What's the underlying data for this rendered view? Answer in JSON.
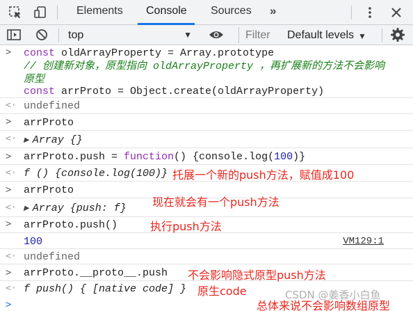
{
  "tabs": {
    "elements": "Elements",
    "console": "Console",
    "sources": "Sources",
    "more": "»"
  },
  "toolbar": {
    "context": "top",
    "filter_placeholder": "Filter",
    "levels": "Default levels"
  },
  "console": {
    "r1_kw": "const",
    "r1_rest": " oldArrayProperty = Array.prototype",
    "r1_comment1": "// 创建新对象，原型指向 oldArrayProperty ，再扩展新的方法不会影响",
    "r1_comment2": "原型",
    "r1_kw2": "const",
    "r1_rest2": " arrProto = Object.create(oldArrayProperty)",
    "r2": "undefined",
    "r3": "arrProto",
    "r4": "Array {}",
    "r5_a": "arrProto.push = ",
    "r5_kw": "function",
    "r5_b": "() {console.log(",
    "r5_num": "100",
    "r5_c": ")}",
    "r6": "f () {console.log(100)}",
    "r6_note": "托展一个新的push方法，赋值成100",
    "r7": "arrProto",
    "r8": "Array {push: f}",
    "r8_note": "现在就会有一个push方法",
    "r9": "arrProto.push()",
    "r9_note": "执行push方法",
    "r10": "100",
    "r10_link": "VM129:1",
    "r11": "undefined",
    "r12": "arrProto.__proto__.push",
    "r12_note": "不会影响隐式原型push方法",
    "r13": "f push() { [native code] }",
    "r13_note": "原生code",
    "r14_note": "总体来说不会影响数组原型",
    "watermark": "CSDN @姜香小白鱼"
  },
  "colors": {
    "keyword": "#8f2eb6",
    "comment": "#1a7f1a",
    "annotation": "#e8281f",
    "number": "#1c1caf",
    "tab_active_underline": "#1a73e8"
  }
}
